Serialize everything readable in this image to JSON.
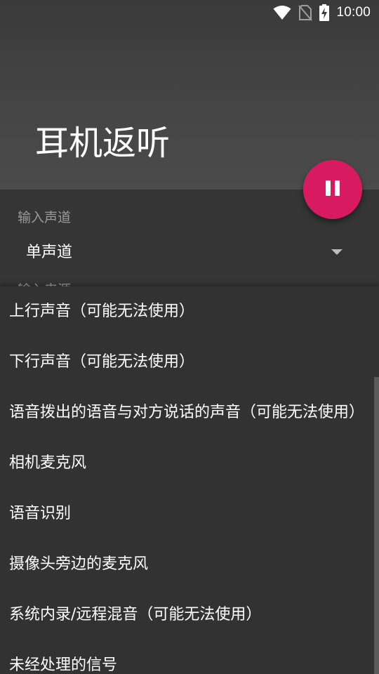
{
  "status_bar": {
    "time": "10:00",
    "icons": [
      "wifi-icon",
      "no-sim-icon",
      "battery-charging-icon"
    ]
  },
  "header": {
    "title": "耳机返听"
  },
  "fab": {
    "icon": "pause-icon",
    "color": "#d81b60"
  },
  "settings": {
    "channel_label": "输入声道",
    "channel_value": "单声道",
    "source_label": "输入来源"
  },
  "source_options": [
    "上行声音（可能无法使用）",
    "下行声音（可能无法使用）",
    "语音拨出的语音与对方说话的声音（可能无法使用）",
    "相机麦克风",
    "语音识别",
    "摄像头旁边的麦克风",
    "系统内录/远程混音（可能无法使用）",
    "未经处理的信号"
  ],
  "theme": {
    "background": "#303030",
    "accent": "#d81b60",
    "text_primary": "#ffffff",
    "text_secondary": "#9a9a9a"
  }
}
